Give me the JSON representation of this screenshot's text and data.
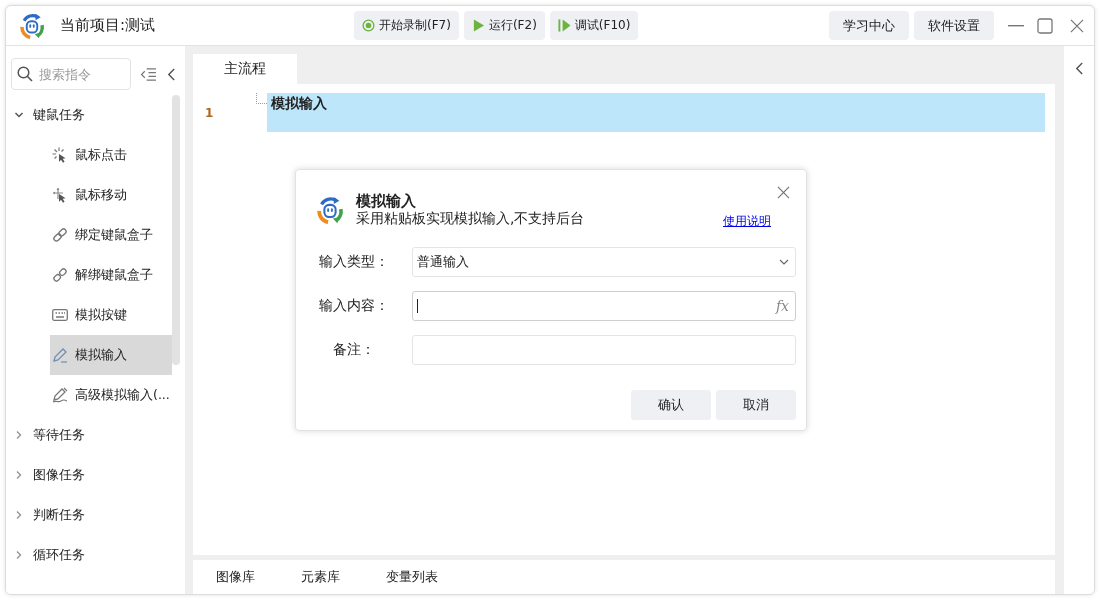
{
  "title_bar": {
    "title": "当前项目:测试",
    "toolbar": [
      {
        "label": "开始录制(F7)",
        "kind": "record"
      },
      {
        "label": "运行(F2)",
        "kind": "run"
      },
      {
        "label": "调试(F10)",
        "kind": "debug"
      }
    ],
    "right_buttons": [
      "学习中心",
      "软件设置"
    ]
  },
  "sidebar": {
    "search": {
      "placeholder": "搜索指令"
    },
    "tree": [
      {
        "label": "键鼠任务",
        "expanded": true,
        "children": [
          {
            "label": "鼠标点击",
            "kind": "click",
            "selected": false
          },
          {
            "label": "鼠标移动",
            "kind": "move",
            "selected": false
          },
          {
            "label": "绑定键鼠盒子",
            "kind": "bind",
            "selected": false
          },
          {
            "label": "解绑键鼠盒子",
            "kind": "unbind",
            "selected": false
          },
          {
            "label": "模拟按键",
            "kind": "keys",
            "selected": false
          },
          {
            "label": "模拟输入",
            "kind": "input",
            "selected": true
          },
          {
            "label": "高级模拟输入(...",
            "kind": "advanced",
            "selected": false
          }
        ]
      },
      {
        "label": "等待任务",
        "expanded": false
      },
      {
        "label": "图像任务",
        "expanded": false
      },
      {
        "label": "判断任务",
        "expanded": false
      },
      {
        "label": "循环任务",
        "expanded": false
      }
    ]
  },
  "editor": {
    "tabs": [
      {
        "label": "主流程",
        "selected": true
      }
    ],
    "lines": [
      {
        "number": "1",
        "text": "模拟输入",
        "selected": true
      }
    ]
  },
  "bottom_tabs": [
    "图像库",
    "元素库",
    "变量列表"
  ],
  "dialog": {
    "title": "模拟输入",
    "subtitle": "采用粘贴板实现模拟输入,不支持后台",
    "help_link": "使用说明",
    "fields": [
      {
        "label": "输入类型：",
        "kind": "select",
        "value": "普通输入",
        "focused": false
      },
      {
        "label": "输入内容：",
        "kind": "expression",
        "function_button": "fx",
        "focused": true
      },
      {
        "label": "备注：",
        "kind": "text",
        "focused": false
      }
    ],
    "buttons": [
      "确认",
      "取消"
    ]
  }
}
